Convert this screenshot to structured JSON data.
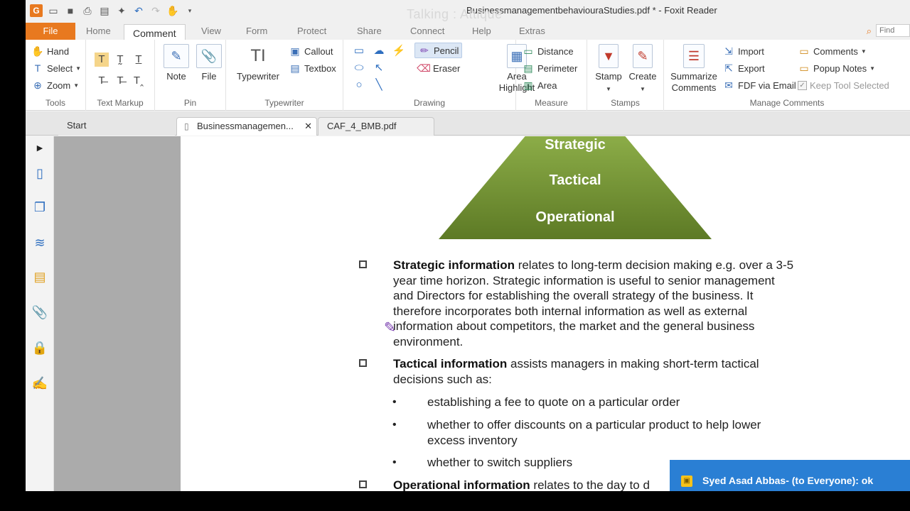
{
  "window": {
    "title": "BusinessmanagementbehaviouraStudies.pdf * - Foxit Reader",
    "overlay_title": "Talking : Attique"
  },
  "menu": {
    "tabs": [
      "File",
      "Home",
      "Comment",
      "View",
      "Form",
      "Protect",
      "Share",
      "Connect",
      "Help",
      "Extras"
    ],
    "active": "Comment",
    "find_placeholder": "Find"
  },
  "ribbon": {
    "tools": {
      "label": "Tools",
      "hand": "Hand",
      "select": "Select",
      "zoom": "Zoom"
    },
    "text_markup": {
      "label": "Text Markup"
    },
    "pin": {
      "label": "Pin",
      "note": "Note",
      "file": "File"
    },
    "typewriter": {
      "label": "Typewriter",
      "typewriter": "Typewriter",
      "callout": "Callout",
      "textbox": "Textbox"
    },
    "drawing": {
      "label": "Drawing",
      "pencil": "Pencil",
      "eraser": "Eraser",
      "area_highlight_1": "Area",
      "area_highlight_2": "Highlight"
    },
    "measure": {
      "label": "Measure",
      "distance": "Distance",
      "perimeter": "Perimeter",
      "area": "Area"
    },
    "stamps": {
      "label": "Stamps",
      "stamp": "Stamp",
      "create": "Create"
    },
    "manage_comments": {
      "label": "Manage Comments",
      "summarize_1": "Summarize",
      "summarize_2": "Comments",
      "import": "Import",
      "export": "Export",
      "fdf": "FDF via Email",
      "comments": "Comments",
      "popup_notes": "Popup Notes",
      "keep_tool": "Keep Tool Selected"
    }
  },
  "doc_tabs": [
    {
      "label": "Start"
    },
    {
      "label": "Businessmanagemen...",
      "active": true
    },
    {
      "label": "CAF_4_BMB.pdf"
    }
  ],
  "document": {
    "pyramid": [
      "Strategic",
      "Tactical",
      "Operational"
    ],
    "strategic_heading": "Strategic information",
    "strategic_l1": " relates to long-term decision making e.g. over a 3-5",
    "strategic_l2": "year time horizon. Strategic information is useful to senior management",
    "strategic_l3": "and Directors for establishing the overall strategy of the business. It",
    "strategic_l4": "therefore incorporates both internal information as well as external",
    "strategic_l5": "information about competitors, the market and the general business",
    "strategic_l6": "environment.",
    "tactical_heading": "Tactical information",
    "tactical_l1": " assists managers in making short-term tactical",
    "tactical_l2": "decisions such as:",
    "bullet_1": "establishing a fee to quote on a particular order",
    "bullet_2a": "whether to offer discounts on a particular product to help lower",
    "bullet_2b": "excess inventory",
    "bullet_3": "whether to switch suppliers",
    "operational_heading": "Operational information",
    "operational_l1": " relates to the day to d"
  },
  "chat": {
    "message": "Syed Asad Abbas- (to Everyone): ok"
  },
  "colors": {
    "accent": "#e8791f",
    "pyramid": "#6e8f2e",
    "chat_bg": "#2a7fd4"
  }
}
